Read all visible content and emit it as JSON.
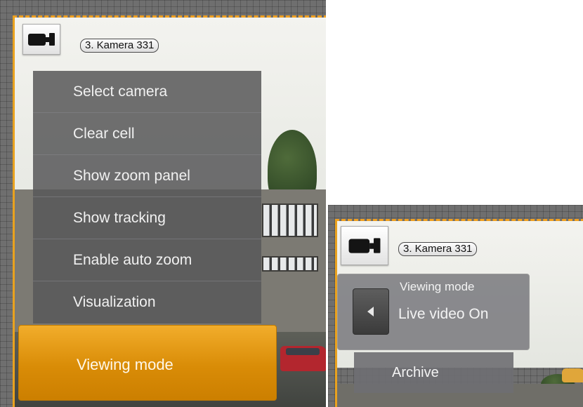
{
  "left_panel": {
    "camera_label": "3. Kamera 331",
    "camera_icon": "video-camera-icon",
    "menu_items": [
      "Select camera",
      "Clear cell",
      "Show zoom panel",
      "Show tracking",
      "Enable auto zoom",
      "Visualization"
    ],
    "active_item": "Viewing mode"
  },
  "right_panel": {
    "camera_label": "3. Kamera 331",
    "camera_icon": "video-camera-icon",
    "viewing_mode": {
      "title": "Viewing mode",
      "value": "Live video On",
      "arrow_icon": "triangle-left-icon"
    },
    "archive_label": "Archive"
  },
  "colors": {
    "accent": "#e9a21f",
    "menu_bg": "#58585a",
    "highlight": "#d98c07"
  }
}
